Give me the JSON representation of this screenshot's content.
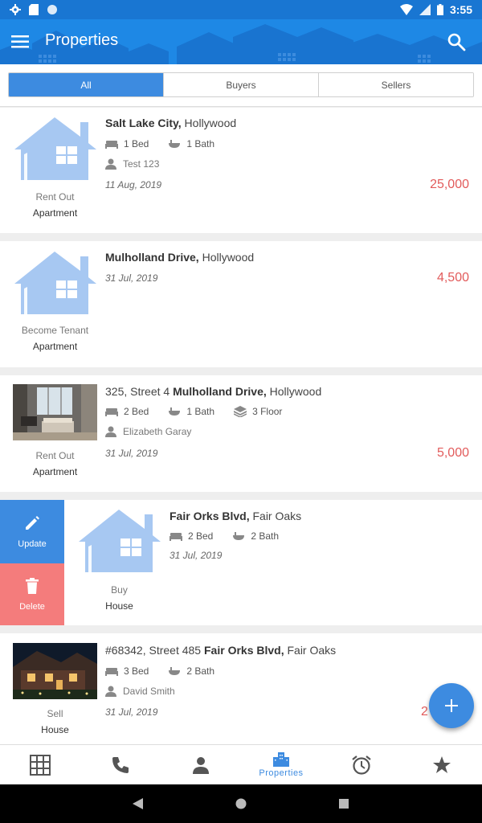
{
  "status_bar": {
    "time": "3:55"
  },
  "app_bar": {
    "title": "Properties"
  },
  "tabs": [
    {
      "label": "All",
      "active": true
    },
    {
      "label": "Buyers",
      "active": false
    },
    {
      "label": "Sellers",
      "active": false
    }
  ],
  "listings": [
    {
      "address_bold": "Salt Lake City,",
      "address_rest": " Hollywood",
      "beds": "1 Bed",
      "baths": "1 Bath",
      "owner": "Test 123",
      "date": "11 Aug, 2019",
      "price": "25,000",
      "type": "Rent Out",
      "kind": "Apartment",
      "image": "house-icon"
    },
    {
      "address_bold": "Mulholland Drive,",
      "address_rest": " Hollywood",
      "date": "31 Jul, 2019",
      "price": "4,500",
      "type": "Become Tenant",
      "kind": "Apartment",
      "image": "house-icon"
    },
    {
      "address_prefix": "325, Street 4 ",
      "address_bold": "Mulholland Drive,",
      "address_rest": " Hollywood",
      "beds": "2 Bed",
      "baths": "1 Bath",
      "floors": "3 Floor",
      "owner": "Elizabeth Garay",
      "date": "31 Jul, 2019",
      "price": "5,000",
      "type": "Rent Out",
      "kind": "Apartment",
      "image": "living-room-photo"
    },
    {
      "address_bold": "Fair Orks Blvd,",
      "address_rest": " Fair Oaks",
      "beds": "2 Bed",
      "baths": "2 Bath",
      "date": "31 Jul, 2019",
      "type": "Buy",
      "kind": "House",
      "image": "house-icon",
      "swipe_actions": {
        "update": "Update",
        "delete": "Delete"
      }
    },
    {
      "address_prefix": "#68342, Street 485 ",
      "address_bold": "Fair Orks Blvd,",
      "address_rest": " Fair Oaks",
      "beds": "3 Bed",
      "baths": "2 Bath",
      "owner": "David Smith",
      "date": "31 Jul, 2019",
      "price_partial": "2",
      "type": "Sell",
      "kind": "House",
      "image": "house-night-photo"
    }
  ],
  "bottom_nav": [
    {
      "icon": "grid-icon",
      "label": ""
    },
    {
      "icon": "phone-icon",
      "label": ""
    },
    {
      "icon": "person-icon",
      "label": ""
    },
    {
      "icon": "building-icon",
      "label": "Properties",
      "active": true
    },
    {
      "icon": "alarm-icon",
      "label": ""
    },
    {
      "icon": "star-icon",
      "label": ""
    }
  ],
  "colors": {
    "primary": "#1e88e5",
    "status_bar": "#1976d2",
    "accent": "#3d8be0",
    "price": "#e25b5b",
    "delete": "#f47c7c",
    "house_icon": "#a7c8f2"
  }
}
